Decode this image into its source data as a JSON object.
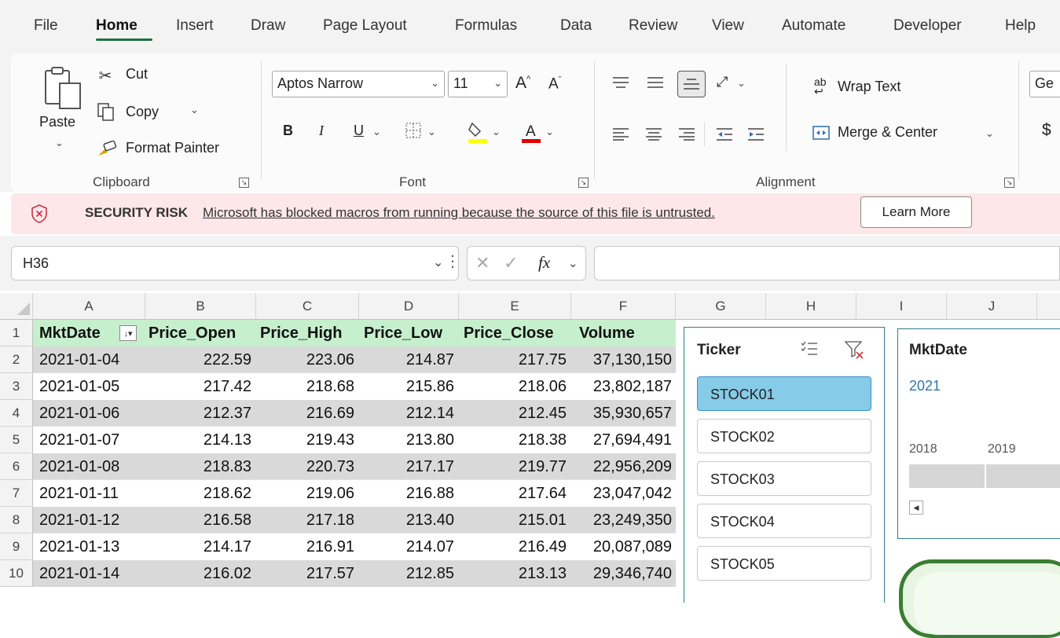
{
  "menu": {
    "tabs": [
      "File",
      "Home",
      "Insert",
      "Draw",
      "Page Layout",
      "Formulas",
      "Data",
      "Review",
      "View",
      "Automate",
      "Developer",
      "Help"
    ],
    "active": "Home"
  },
  "ribbon": {
    "clipboard": {
      "paste_label": "Paste",
      "cut_label": "Cut",
      "copy_label": "Copy",
      "format_painter_label": "Format Painter",
      "group_label": "Clipboard"
    },
    "font": {
      "font_name": "Aptos Narrow",
      "font_size": "11",
      "bold": "B",
      "italic": "I",
      "underline": "U",
      "group_label": "Font",
      "highlight_color": "#ffff00",
      "font_color": "#e00000"
    },
    "alignment": {
      "wrap_text_label": "Wrap Text",
      "merge_center_label": "Merge & Center",
      "group_label": "Alignment"
    },
    "number": {
      "format_partial": "Ge",
      "currency_partial": "$"
    }
  },
  "security_bar": {
    "title": "SECURITY RISK",
    "message": "Microsoft has blocked macros from running because the source of this file is untrusted.",
    "button_label": "Learn More"
  },
  "formula_bar": {
    "name_box": "H36",
    "fx_label": "fx",
    "formula": ""
  },
  "sheet": {
    "columns": [
      "A",
      "B",
      "C",
      "D",
      "E",
      "F",
      "G",
      "H",
      "I",
      "J"
    ],
    "row_numbers": [
      "1",
      "2",
      "3",
      "4",
      "5",
      "6",
      "7",
      "8",
      "9",
      "10"
    ],
    "headers": [
      "MktDate",
      "Price_Open",
      "Price_High",
      "Price_Low",
      "Price_Close",
      "Volume"
    ],
    "rows": [
      [
        "2021-01-04",
        "222.59",
        "223.06",
        "214.87",
        "217.75",
        "37,130,150"
      ],
      [
        "2021-01-05",
        "217.42",
        "218.68",
        "215.86",
        "218.06",
        "23,802,187"
      ],
      [
        "2021-01-06",
        "212.37",
        "216.69",
        "212.14",
        "212.45",
        "35,930,657"
      ],
      [
        "2021-01-07",
        "214.13",
        "219.43",
        "213.80",
        "218.38",
        "27,694,491"
      ],
      [
        "2021-01-08",
        "218.83",
        "220.73",
        "217.17",
        "219.77",
        "22,956,209"
      ],
      [
        "2021-01-11",
        "218.62",
        "219.06",
        "216.88",
        "217.64",
        "23,047,042"
      ],
      [
        "2021-01-12",
        "216.58",
        "217.18",
        "213.40",
        "215.01",
        "23,249,350"
      ],
      [
        "2021-01-13",
        "214.17",
        "216.91",
        "214.07",
        "216.49",
        "20,087,089"
      ],
      [
        "2021-01-14",
        "216.02",
        "217.57",
        "212.85",
        "213.13",
        "29,346,740"
      ]
    ],
    "header_fill": "#c6efce",
    "band_fill": "#d9d9d9"
  },
  "ticker_slicer": {
    "title": "Ticker",
    "items": [
      "STOCK01",
      "STOCK02",
      "STOCK03",
      "STOCK04",
      "STOCK05"
    ],
    "selected": "STOCK01",
    "selected_color": "#86cbe8"
  },
  "date_slicer": {
    "title": "MktDate",
    "selection": "2021",
    "years": [
      "2018",
      "2019"
    ]
  }
}
